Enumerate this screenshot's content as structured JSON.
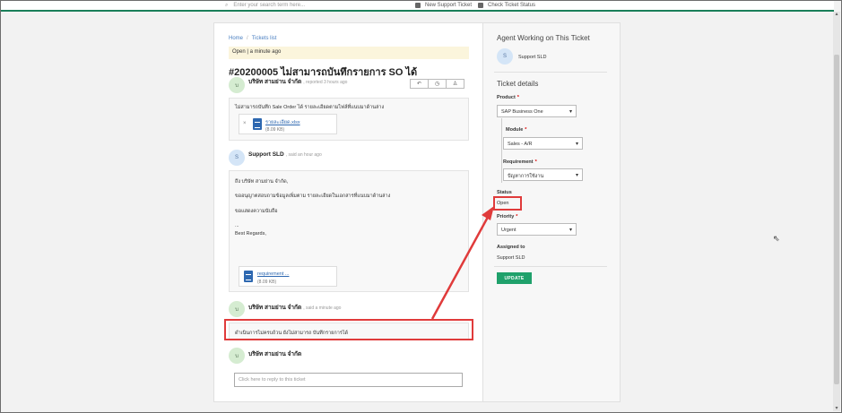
{
  "topbar": {
    "search_placeholder": "Enter your search term here...",
    "new_ticket": "New Support Ticket",
    "check_status": "Check Ticket Status"
  },
  "breadcrumb": {
    "home": "Home",
    "sep": "/",
    "current": "Tickets list"
  },
  "status_bar": {
    "state": "Open",
    "time": "a minute ago"
  },
  "ticket": {
    "title": "#20200005 ไม่สามารถบันทึกรายการ SO ได้"
  },
  "thread": [
    {
      "initials": "บ",
      "author": "บริษัท สามย่าน จำกัด",
      "meta": ", reported 3 hours ago",
      "lines": [
        "ไม่สามารถบันทึก Sale Order ได้ รายละเอียดตามไฟล์ที่แนบมาด้านล่าง"
      ],
      "attachment": {
        "name": "รายละเอียด.xlsx",
        "size": "(8.09 KB)"
      }
    },
    {
      "initials": "S",
      "author": "Support SLD",
      "meta": ", said an hour ago",
      "lines": [
        "ถึง บริษัท สามย่าน จำกัด,",
        "ขออนุญาตสอบถามข้อมูลเพิ่มตาม รายละเอียดในเอกสารที่แนบมาด้านล่าง",
        "ขอแสดงความนับถือ",
        "...",
        "Best Regards,"
      ],
      "attachment": {
        "name": "requirement ...",
        "size": "(8.09 KB)"
      }
    },
    {
      "initials": "บ",
      "author": "บริษัท สามย่าน จำกัด",
      "meta": ", said a minute ago",
      "lines": [
        "ดำเนินการไม่ครบถ้วน ยังไม่สามารถ บันทึกรายการได้"
      ]
    }
  ],
  "reply": {
    "initials": "บ",
    "author": "บริษัท สามย่าน จำกัด",
    "placeholder": "Click here to reply to this ticket"
  },
  "buttons": {
    "reply_icon": "↶",
    "clock_icon": "◷",
    "user_icon": "♙"
  },
  "sidebar": {
    "agent_heading": "Agent Working on This Ticket",
    "agent_initials": "S",
    "agent_name": "Support SLD",
    "details_heading": "Ticket details",
    "product_label": "Product",
    "product_value": "SAP Business One",
    "module_label": "Module",
    "module_value": "Sales - A/R",
    "requirement_label": "Requirement",
    "requirement_value": "ปัญหาการใช้งาน",
    "status_label": "Status",
    "status_value": "Open",
    "priority_label": "Priority",
    "priority_value": "Urgent",
    "assigned_label": "Assigned to",
    "assigned_value": "Support SLD",
    "update_label": "UPDATE",
    "required_mark": "*"
  },
  "colors": {
    "accent": "#1fa16b",
    "annotation": "#e03b3b",
    "link": "#2e68b0"
  }
}
